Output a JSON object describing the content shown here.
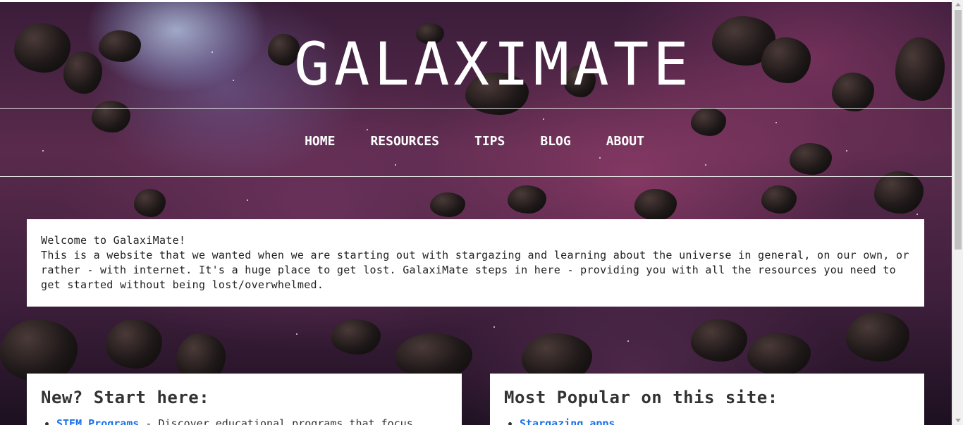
{
  "site": {
    "title": "GALAXIMATE"
  },
  "nav": [
    {
      "label": "HOME"
    },
    {
      "label": "RESOURCES"
    },
    {
      "label": "TIPS"
    },
    {
      "label": "BLOG"
    },
    {
      "label": "ABOUT"
    }
  ],
  "welcome": {
    "heading": "Welcome to GalaxiMate!",
    "body": "This is a website that we wanted when we are starting out with stargazing and learning about the universe in general, on our own, or rather - with internet. It's a huge place to get lost. GalaxiMate steps in here - providing you with all the resources you need to get started without being lost/overwhelmed."
  },
  "start_here": {
    "title": "New? Start here:",
    "items": [
      {
        "link": "STEM Programs",
        "text": " - Discover educational programs that focus"
      }
    ]
  },
  "popular": {
    "title": "Most Popular on this site:",
    "items": [
      {
        "link": "Stargazing apps",
        "text": ""
      }
    ]
  },
  "colors": {
    "link": "#1a73e8",
    "panel": "#ffffff",
    "text": "#222222"
  }
}
